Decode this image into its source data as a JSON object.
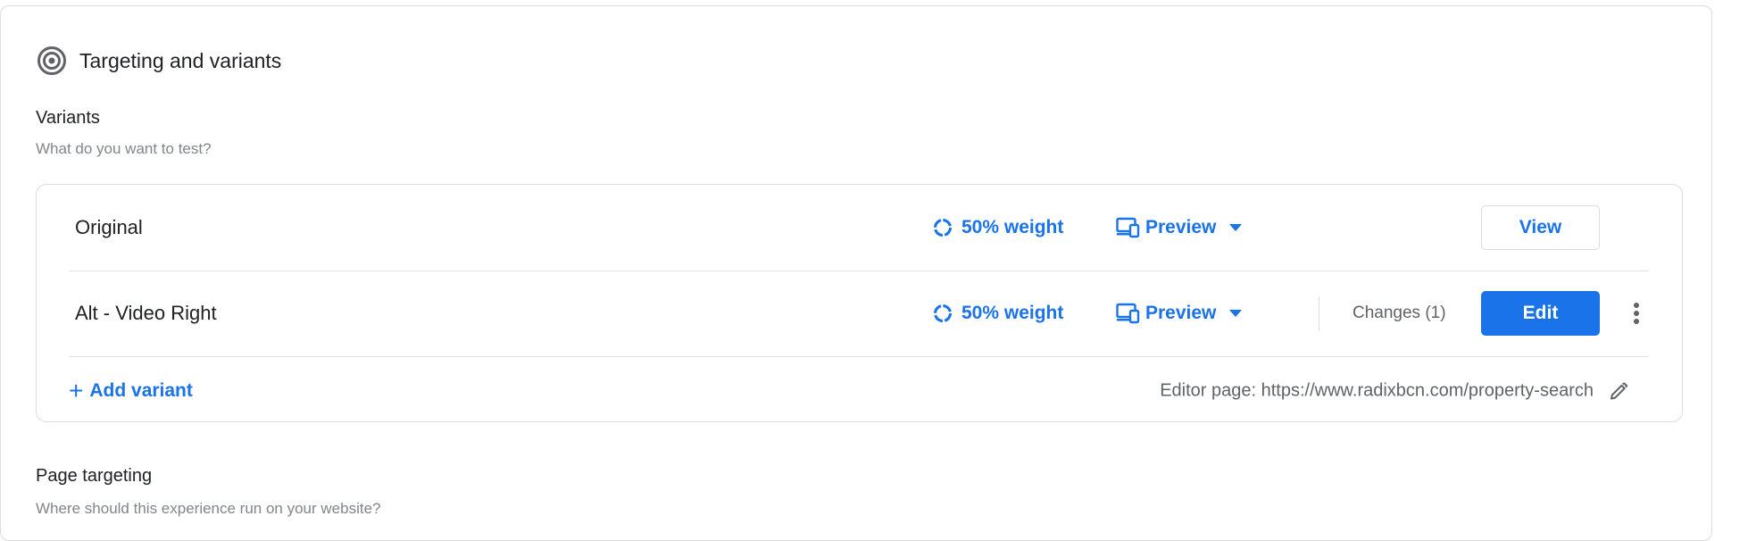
{
  "section": {
    "title": "Targeting and variants",
    "icon": "target-icon"
  },
  "variants": {
    "heading": "Variants",
    "description": "What do you want to test?",
    "rows": [
      {
        "name": "Original",
        "weight": "50% weight",
        "preview": "Preview",
        "button": "View"
      },
      {
        "name": "Alt - Video Right",
        "weight": "50% weight",
        "preview": "Preview",
        "changes": "Changes (1)",
        "button": "Edit"
      }
    ],
    "add_variant": "Add variant",
    "editor_page": "Editor page: https://www.radixbcn.com/property-search"
  },
  "page_targeting": {
    "heading": "Page targeting",
    "description": "Where should this experience run on your website?"
  },
  "colors": {
    "accent": "#1a73e8",
    "text": "#202124",
    "muted": "#80868b",
    "border": "#dadce0"
  }
}
